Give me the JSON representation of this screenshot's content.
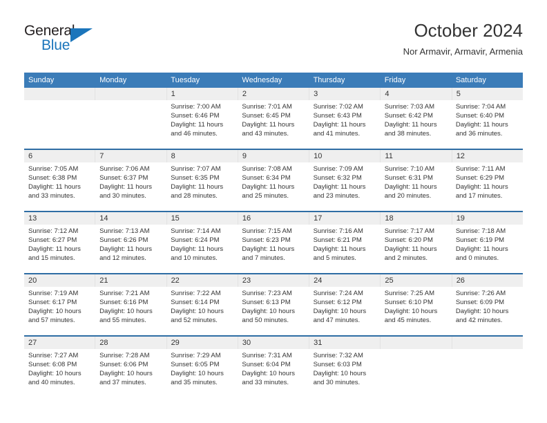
{
  "logo": {
    "word_one": "General",
    "word_two": "Blue",
    "triangle_icon": "triangle-icon",
    "accent_color": "#1b75bb"
  },
  "header": {
    "title": "October 2024",
    "subtitle": "Nor Armavir, Armavir, Armenia"
  },
  "calendar": {
    "header_bg": "#3b7cb8",
    "row_divider_color": "#2e6da4",
    "daynum_band_bg": "#efefef",
    "weekday_headers": [
      "Sunday",
      "Monday",
      "Tuesday",
      "Wednesday",
      "Thursday",
      "Friday",
      "Saturday"
    ],
    "weeks": [
      [
        {
          "day": "",
          "sunrise": "",
          "sunset": "",
          "daylight": ""
        },
        {
          "day": "",
          "sunrise": "",
          "sunset": "",
          "daylight": ""
        },
        {
          "day": "1",
          "sunrise": "Sunrise: 7:00 AM",
          "sunset": "Sunset: 6:46 PM",
          "daylight": "Daylight: 11 hours and 46 minutes."
        },
        {
          "day": "2",
          "sunrise": "Sunrise: 7:01 AM",
          "sunset": "Sunset: 6:45 PM",
          "daylight": "Daylight: 11 hours and 43 minutes."
        },
        {
          "day": "3",
          "sunrise": "Sunrise: 7:02 AM",
          "sunset": "Sunset: 6:43 PM",
          "daylight": "Daylight: 11 hours and 41 minutes."
        },
        {
          "day": "4",
          "sunrise": "Sunrise: 7:03 AM",
          "sunset": "Sunset: 6:42 PM",
          "daylight": "Daylight: 11 hours and 38 minutes."
        },
        {
          "day": "5",
          "sunrise": "Sunrise: 7:04 AM",
          "sunset": "Sunset: 6:40 PM",
          "daylight": "Daylight: 11 hours and 36 minutes."
        }
      ],
      [
        {
          "day": "6",
          "sunrise": "Sunrise: 7:05 AM",
          "sunset": "Sunset: 6:38 PM",
          "daylight": "Daylight: 11 hours and 33 minutes."
        },
        {
          "day": "7",
          "sunrise": "Sunrise: 7:06 AM",
          "sunset": "Sunset: 6:37 PM",
          "daylight": "Daylight: 11 hours and 30 minutes."
        },
        {
          "day": "8",
          "sunrise": "Sunrise: 7:07 AM",
          "sunset": "Sunset: 6:35 PM",
          "daylight": "Daylight: 11 hours and 28 minutes."
        },
        {
          "day": "9",
          "sunrise": "Sunrise: 7:08 AM",
          "sunset": "Sunset: 6:34 PM",
          "daylight": "Daylight: 11 hours and 25 minutes."
        },
        {
          "day": "10",
          "sunrise": "Sunrise: 7:09 AM",
          "sunset": "Sunset: 6:32 PM",
          "daylight": "Daylight: 11 hours and 23 minutes."
        },
        {
          "day": "11",
          "sunrise": "Sunrise: 7:10 AM",
          "sunset": "Sunset: 6:31 PM",
          "daylight": "Daylight: 11 hours and 20 minutes."
        },
        {
          "day": "12",
          "sunrise": "Sunrise: 7:11 AM",
          "sunset": "Sunset: 6:29 PM",
          "daylight": "Daylight: 11 hours and 17 minutes."
        }
      ],
      [
        {
          "day": "13",
          "sunrise": "Sunrise: 7:12 AM",
          "sunset": "Sunset: 6:27 PM",
          "daylight": "Daylight: 11 hours and 15 minutes."
        },
        {
          "day": "14",
          "sunrise": "Sunrise: 7:13 AM",
          "sunset": "Sunset: 6:26 PM",
          "daylight": "Daylight: 11 hours and 12 minutes."
        },
        {
          "day": "15",
          "sunrise": "Sunrise: 7:14 AM",
          "sunset": "Sunset: 6:24 PM",
          "daylight": "Daylight: 11 hours and 10 minutes."
        },
        {
          "day": "16",
          "sunrise": "Sunrise: 7:15 AM",
          "sunset": "Sunset: 6:23 PM",
          "daylight": "Daylight: 11 hours and 7 minutes."
        },
        {
          "day": "17",
          "sunrise": "Sunrise: 7:16 AM",
          "sunset": "Sunset: 6:21 PM",
          "daylight": "Daylight: 11 hours and 5 minutes."
        },
        {
          "day": "18",
          "sunrise": "Sunrise: 7:17 AM",
          "sunset": "Sunset: 6:20 PM",
          "daylight": "Daylight: 11 hours and 2 minutes."
        },
        {
          "day": "19",
          "sunrise": "Sunrise: 7:18 AM",
          "sunset": "Sunset: 6:19 PM",
          "daylight": "Daylight: 11 hours and 0 minutes."
        }
      ],
      [
        {
          "day": "20",
          "sunrise": "Sunrise: 7:19 AM",
          "sunset": "Sunset: 6:17 PM",
          "daylight": "Daylight: 10 hours and 57 minutes."
        },
        {
          "day": "21",
          "sunrise": "Sunrise: 7:21 AM",
          "sunset": "Sunset: 6:16 PM",
          "daylight": "Daylight: 10 hours and 55 minutes."
        },
        {
          "day": "22",
          "sunrise": "Sunrise: 7:22 AM",
          "sunset": "Sunset: 6:14 PM",
          "daylight": "Daylight: 10 hours and 52 minutes."
        },
        {
          "day": "23",
          "sunrise": "Sunrise: 7:23 AM",
          "sunset": "Sunset: 6:13 PM",
          "daylight": "Daylight: 10 hours and 50 minutes."
        },
        {
          "day": "24",
          "sunrise": "Sunrise: 7:24 AM",
          "sunset": "Sunset: 6:12 PM",
          "daylight": "Daylight: 10 hours and 47 minutes."
        },
        {
          "day": "25",
          "sunrise": "Sunrise: 7:25 AM",
          "sunset": "Sunset: 6:10 PM",
          "daylight": "Daylight: 10 hours and 45 minutes."
        },
        {
          "day": "26",
          "sunrise": "Sunrise: 7:26 AM",
          "sunset": "Sunset: 6:09 PM",
          "daylight": "Daylight: 10 hours and 42 minutes."
        }
      ],
      [
        {
          "day": "27",
          "sunrise": "Sunrise: 7:27 AM",
          "sunset": "Sunset: 6:08 PM",
          "daylight": "Daylight: 10 hours and 40 minutes."
        },
        {
          "day": "28",
          "sunrise": "Sunrise: 7:28 AM",
          "sunset": "Sunset: 6:06 PM",
          "daylight": "Daylight: 10 hours and 37 minutes."
        },
        {
          "day": "29",
          "sunrise": "Sunrise: 7:29 AM",
          "sunset": "Sunset: 6:05 PM",
          "daylight": "Daylight: 10 hours and 35 minutes."
        },
        {
          "day": "30",
          "sunrise": "Sunrise: 7:31 AM",
          "sunset": "Sunset: 6:04 PM",
          "daylight": "Daylight: 10 hours and 33 minutes."
        },
        {
          "day": "31",
          "sunrise": "Sunrise: 7:32 AM",
          "sunset": "Sunset: 6:03 PM",
          "daylight": "Daylight: 10 hours and 30 minutes."
        },
        {
          "day": "",
          "sunrise": "",
          "sunset": "",
          "daylight": ""
        },
        {
          "day": "",
          "sunrise": "",
          "sunset": "",
          "daylight": ""
        }
      ]
    ]
  }
}
